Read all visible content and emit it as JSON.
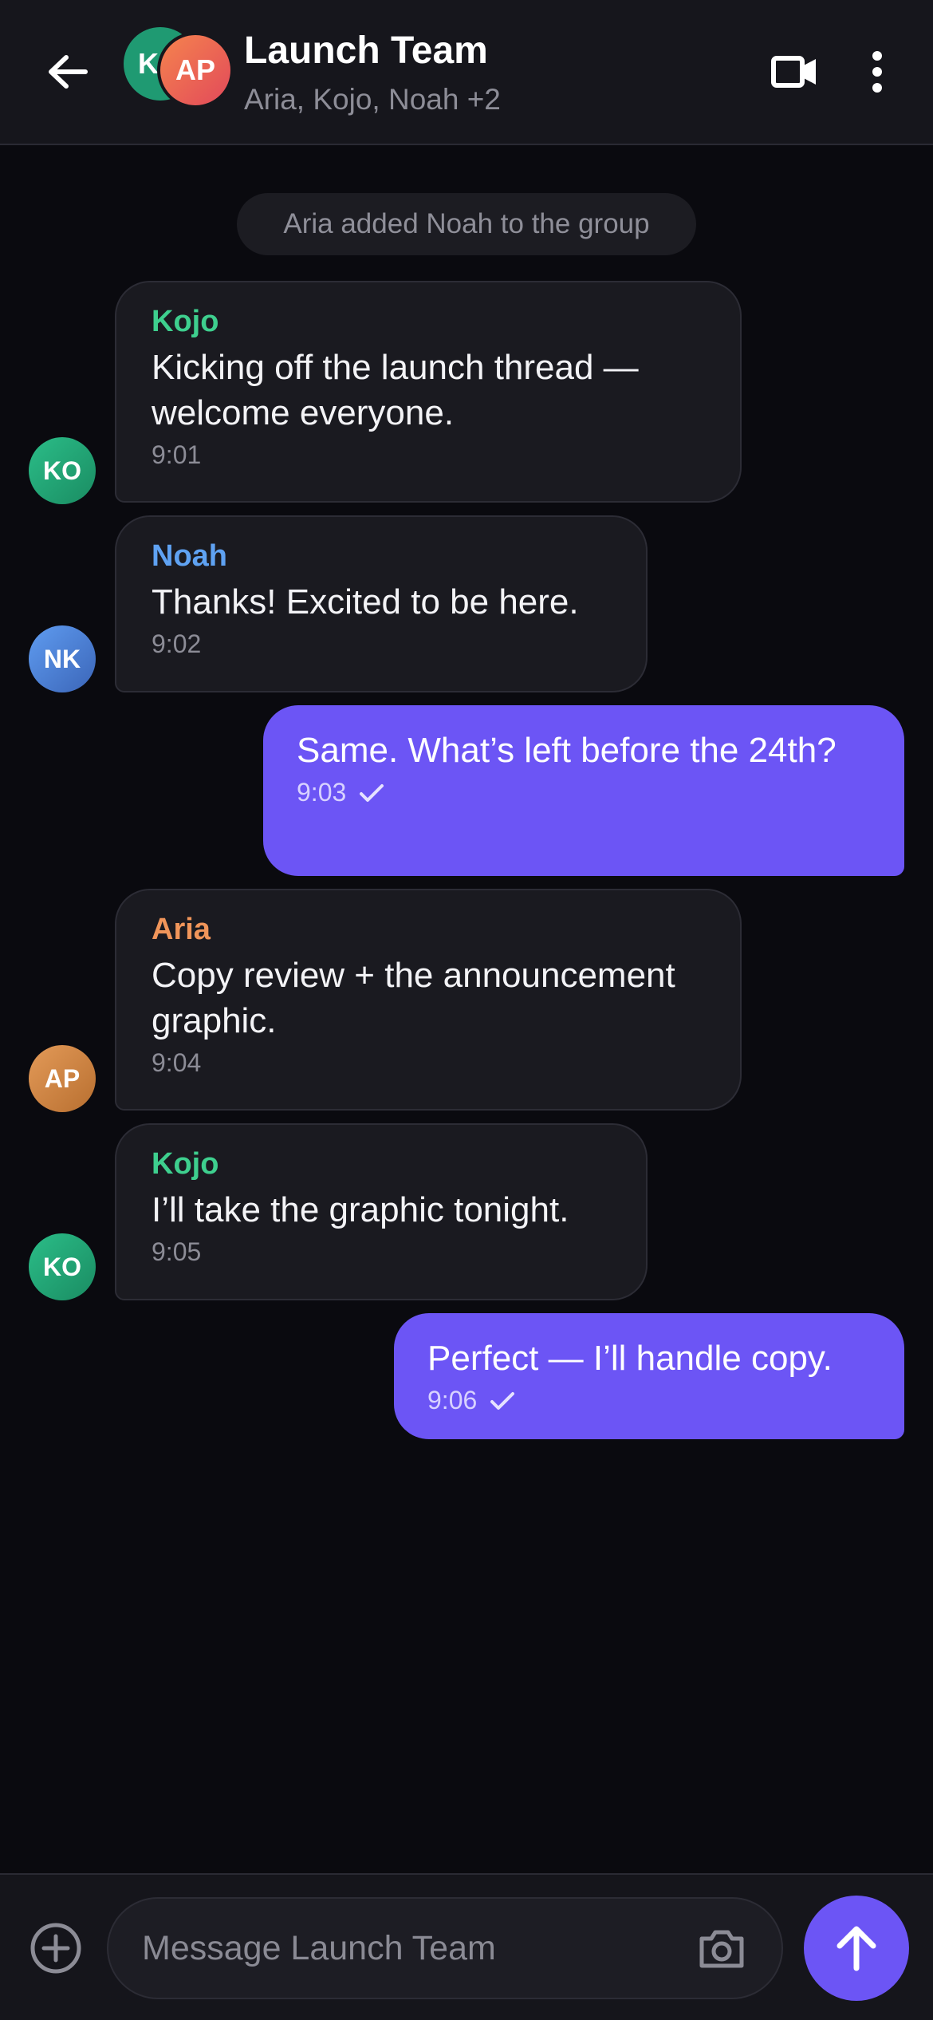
{
  "header": {
    "title": "Launch Team",
    "subtitle": "Aria, Kojo, Noah +2",
    "avatars": [
      {
        "initials": "K",
        "color": "#1f9a72"
      },
      {
        "initials": "AP",
        "color": "#e2495a"
      }
    ],
    "icons": {
      "back": "arrow-left-icon",
      "video": "video-camera-icon",
      "more": "more-vertical-icon"
    }
  },
  "system_message": "Aria added Noah to the group",
  "messages": [
    {
      "direction": "incoming",
      "sender": "Kojo",
      "sender_color": "#3ecf8e",
      "avatar_initials": "KO",
      "text": "Kicking off the launch thread — welcome everyone.",
      "time": "9:01"
    },
    {
      "direction": "incoming",
      "sender": "Noah",
      "sender_color": "#5fa2f2",
      "avatar_initials": "NK",
      "text": "Thanks! Excited to be here.",
      "time": "9:02"
    },
    {
      "direction": "outgoing",
      "text": "Same. What’s left before the 24th?",
      "time": "9:03",
      "status": "sent"
    },
    {
      "direction": "incoming",
      "sender": "Aria",
      "sender_color": "#f0955a",
      "avatar_initials": "AP",
      "text": "Copy review + the announcement graphic.",
      "time": "9:04"
    },
    {
      "direction": "incoming",
      "sender": "Kojo",
      "sender_color": "#3ecf8e",
      "avatar_initials": "KO",
      "text": "I’ll take the graphic tonight.",
      "time": "9:05"
    },
    {
      "direction": "outgoing",
      "text": "Perfect — I’ll handle copy.",
      "time": "9:06",
      "status": "sent"
    }
  ],
  "composer": {
    "placeholder": "Message Launch Team",
    "value": "",
    "icons": {
      "attach": "plus-circle-icon",
      "camera": "camera-icon",
      "send": "send-arrow-up-icon"
    }
  },
  "colors": {
    "accent": "#6c55f5",
    "background": "#0a0a0f",
    "bubble_incoming": "#1a1a20"
  }
}
